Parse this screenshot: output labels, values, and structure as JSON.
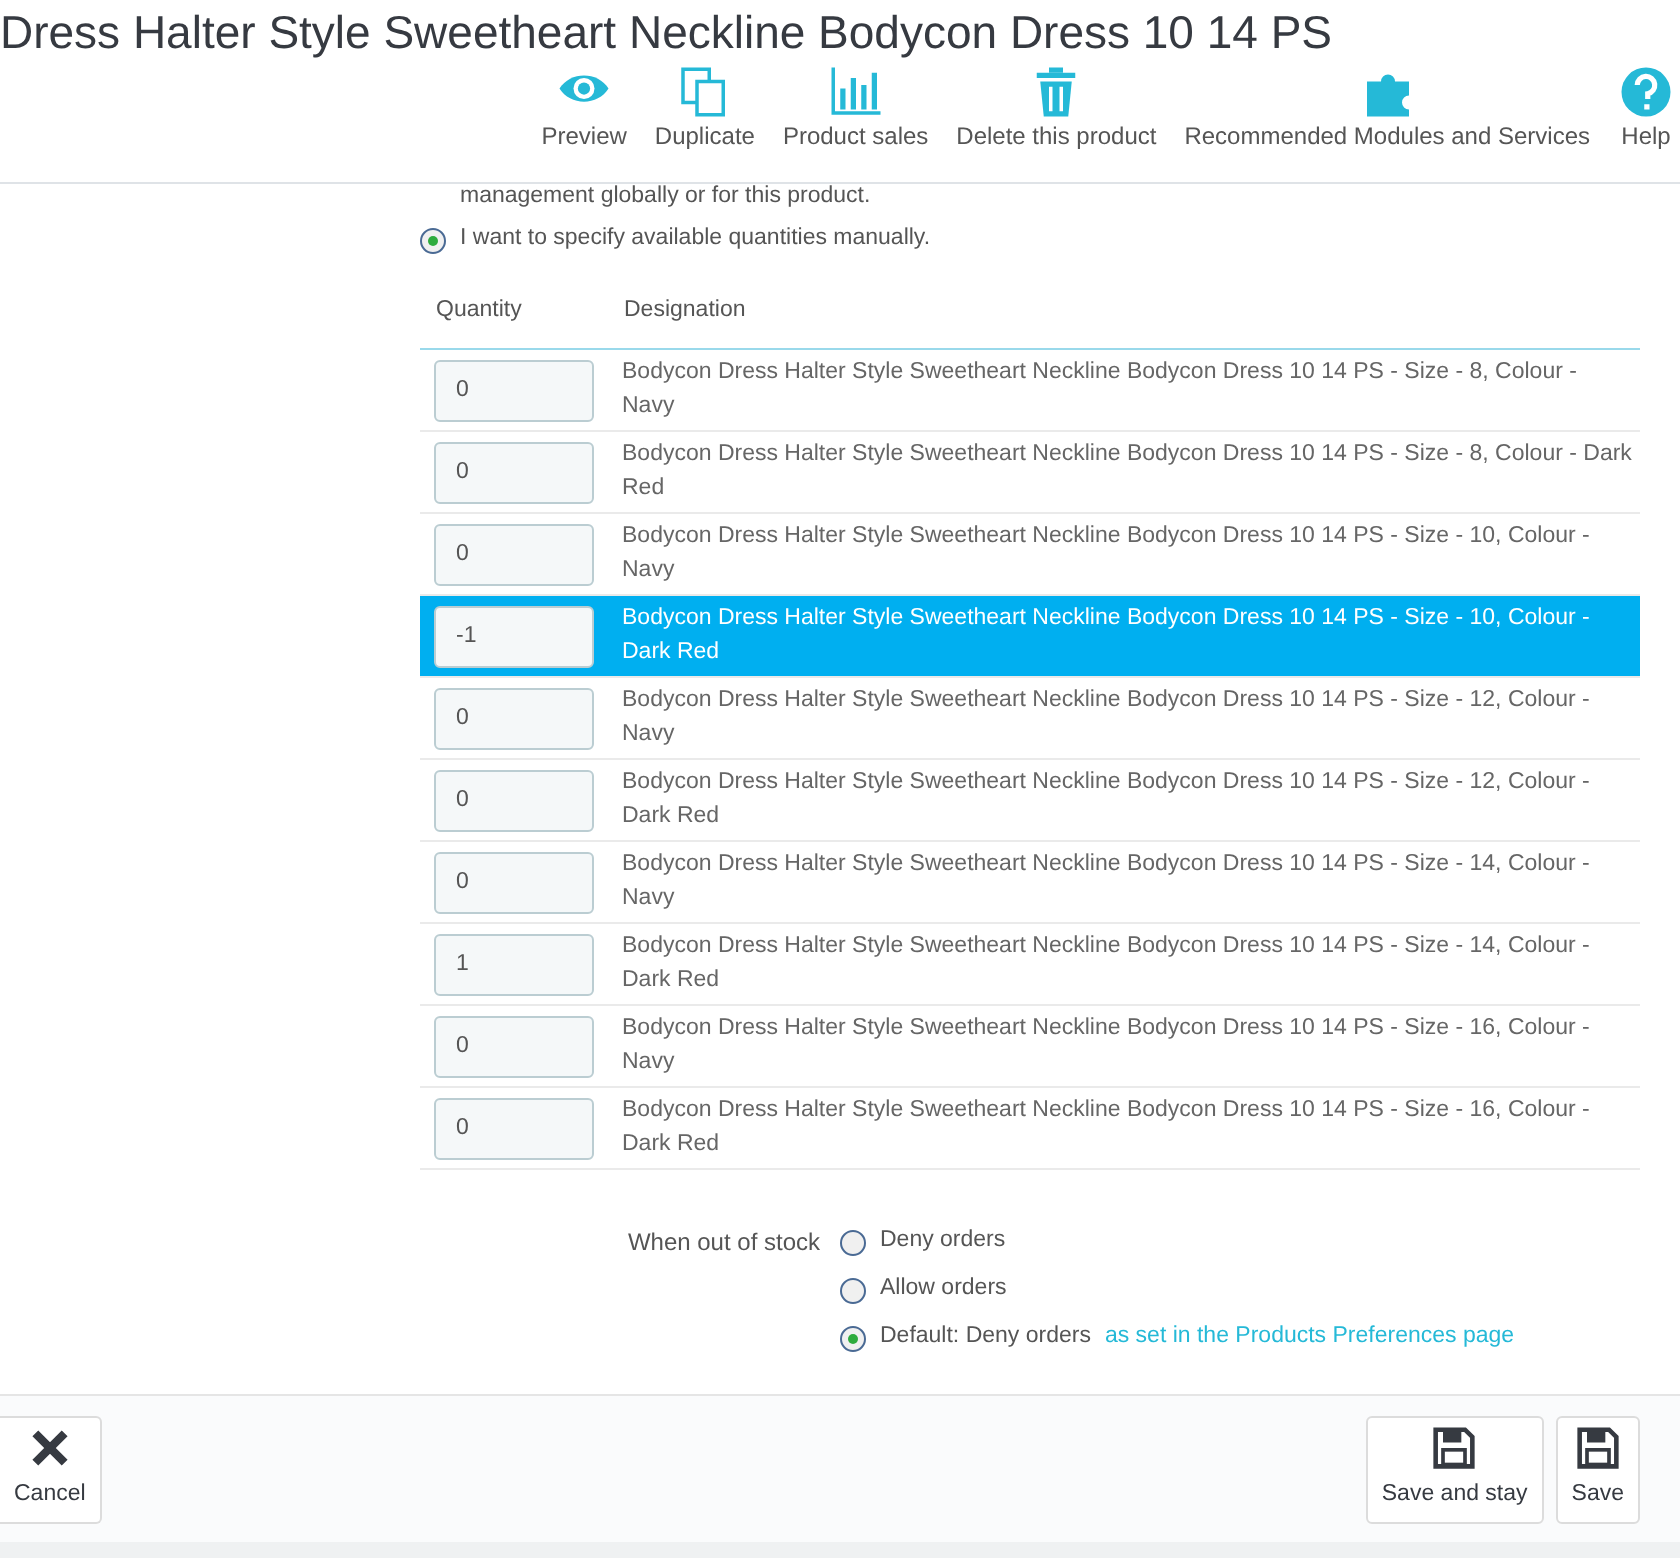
{
  "header": {
    "title": "Dress Halter Style Sweetheart Neckline Bodycon Dress 10 14 PS",
    "toolbar": [
      {
        "kind": "eye",
        "label": "Preview"
      },
      {
        "kind": "copy",
        "label": "Duplicate"
      },
      {
        "kind": "chart",
        "label": "Product sales"
      },
      {
        "kind": "trash",
        "label": "Delete this product"
      },
      {
        "kind": "puzzle",
        "label": "Recommended Modules and Services"
      },
      {
        "kind": "help",
        "label": "Help"
      }
    ]
  },
  "stock_mode": {
    "note": "management globally or for this product.",
    "options": [
      {
        "label": "I want to specify available quantities manually.",
        "selected": true
      }
    ]
  },
  "table": {
    "columns": [
      "Quantity",
      "Designation"
    ],
    "rows": [
      {
        "quantity": "0",
        "designation": "Bodycon Dress Halter Style Sweetheart Neckline Bodycon Dress 10 14 PS - Size - 8, Colour - Navy",
        "selected": false
      },
      {
        "quantity": "0",
        "designation": "Bodycon Dress Halter Style Sweetheart Neckline Bodycon Dress 10 14 PS - Size - 8, Colour - Dark Red",
        "selected": false
      },
      {
        "quantity": "0",
        "designation": "Bodycon Dress Halter Style Sweetheart Neckline Bodycon Dress 10 14 PS - Size - 10, Colour - Navy",
        "selected": false
      },
      {
        "quantity": "-1",
        "designation": "Bodycon Dress Halter Style Sweetheart Neckline Bodycon Dress 10 14 PS - Size - 10, Colour - Dark Red",
        "selected": true
      },
      {
        "quantity": "0",
        "designation": "Bodycon Dress Halter Style Sweetheart Neckline Bodycon Dress 10 14 PS - Size - 12, Colour - Navy",
        "selected": false
      },
      {
        "quantity": "0",
        "designation": "Bodycon Dress Halter Style Sweetheart Neckline Bodycon Dress 10 14 PS - Size - 12, Colour - Dark Red",
        "selected": false
      },
      {
        "quantity": "0",
        "designation": "Bodycon Dress Halter Style Sweetheart Neckline Bodycon Dress 10 14 PS - Size - 14, Colour - Navy",
        "selected": false
      },
      {
        "quantity": "1",
        "designation": "Bodycon Dress Halter Style Sweetheart Neckline Bodycon Dress 10 14 PS - Size - 14, Colour - Dark Red",
        "selected": false
      },
      {
        "quantity": "0",
        "designation": "Bodycon Dress Halter Style Sweetheart Neckline Bodycon Dress 10 14 PS - Size - 16, Colour - Navy",
        "selected": false
      },
      {
        "quantity": "0",
        "designation": "Bodycon Dress Halter Style Sweetheart Neckline Bodycon Dress 10 14 PS - Size - 16, Colour - Dark Red",
        "selected": false
      }
    ]
  },
  "out_of_stock": {
    "label": "When out of stock",
    "options": [
      {
        "label": "Deny orders",
        "selected": false
      },
      {
        "label": "Allow orders",
        "selected": false
      },
      {
        "label": "Default: Deny orders",
        "link": "as set in the Products Preferences page",
        "selected": true
      }
    ]
  },
  "footer": {
    "buttons": [
      {
        "kind": "cancel",
        "label": "Cancel"
      },
      {
        "kind": "save",
        "label": "Save and stay"
      },
      {
        "kind": "save",
        "label": "Save"
      }
    ]
  }
}
